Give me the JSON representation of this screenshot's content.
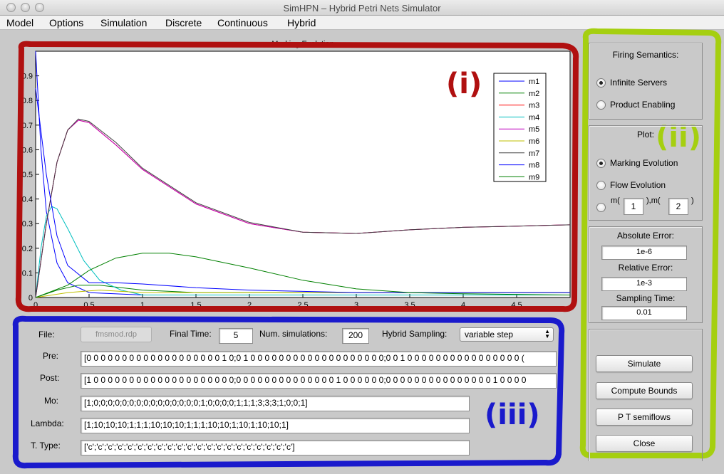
{
  "window": {
    "title": "SimHPN – Hybrid Petri Nets Simulator"
  },
  "menu": [
    "Model",
    "Options",
    "Simulation",
    "Discrete",
    "Continuous",
    "Hybrid"
  ],
  "plot": {
    "title": "Marking Evolution",
    "legend": [
      "m1",
      "m2",
      "m3",
      "m4",
      "m5",
      "m6",
      "m7",
      "m8",
      "m9"
    ]
  },
  "colors": {
    "red_annotation": "#b01010",
    "green_annotation": "#a5cf10",
    "blue_annotation": "#1a1acc"
  },
  "annotations": {
    "i": "(i)",
    "ii": "(ii)",
    "iii": "(iii)"
  },
  "firing": {
    "title": "Firing Semantics:",
    "options": [
      {
        "label": "Infinite Servers",
        "selected": true
      },
      {
        "label": "Product Enabling",
        "selected": false
      }
    ]
  },
  "plot_panel": {
    "title": "Plot:",
    "options": [
      {
        "label": "Marking Evolution",
        "selected": true
      },
      {
        "label": "Flow Evolution",
        "selected": false
      }
    ],
    "m_prefix1": "m(",
    "m_mid": "),m(",
    "m_suffix": ")",
    "m1_value": "1",
    "m2_value": "2"
  },
  "errors": {
    "abs_label": "Absolute Error:",
    "abs_value": "1e-6",
    "rel_label": "Relative Error:",
    "rel_value": "1e-3",
    "samp_label": "Sampling Time:",
    "samp_value": "0.01"
  },
  "buttons": {
    "simulate": "Simulate",
    "compute_bounds": "Compute Bounds",
    "pt_semiflows": "P T semiflows",
    "close": "Close"
  },
  "form": {
    "file_label": "File:",
    "file_button": "fmsmod.rdp",
    "final_time_label": "Final Time:",
    "final_time": "5",
    "num_sim_label": "Num. simulations:",
    "num_sim": "200",
    "hybrid_label": "Hybrid Sampling:",
    "hybrid_value": "variable step",
    "pre_label": "Pre:",
    "pre_value": "[0 0 0 0 0 0 0 0 0 0 0 0 0 0 0 0 0 0 0 1 0;0 1 0 0 0 0 0 0 0 0 0 0 0 0 0 0 0 0 0 0 0;0 0 1 0 0 0 0 0 0 0 0 0 0 0 0 0 0 0 0 (",
    "post_label": "Post:",
    "post_value": "[1 0 0 0 0 0 0 0 0 0 0 0 0 0 0 0 0 0 0 0 0;0 0 0 0 0 0 0 0 0 0 0 0 0 0 1 0 0 0 0 0 0;0 0 0 0 0 0 0 0 0 0 0 0 0 0 0 1 0 0 0 0",
    "mo_label": "Mo:",
    "mo_value": "[1;0;0;0;0;0;0;0;0;0;0;0;0;0;0;0;1;0;0;0;0;1;1;1;3;3;3;1;0;0;1]",
    "lambda_label": "Lambda:",
    "lambda_value": "[1;10;10;10;1;1;1;10;10;10;1;1;1;10;10;1;10;1;10;10;1]",
    "ttype_label": "T. Type:",
    "ttype_value": "['c';'c';'c';'c';'c';'c';'c';'c';'c';'c';'c';'c';'c';'c';'c';'c';'c';'c';'c';'c';'c']"
  },
  "chart_data": {
    "type": "line",
    "title": "Marking Evolution",
    "xlim": [
      0,
      5
    ],
    "ylim": [
      0,
      1
    ],
    "x_ticks": [
      "0",
      "0.5",
      "1",
      "1.5",
      "2",
      "2.5",
      "3",
      "3.5",
      "4",
      "4.5"
    ],
    "y_ticks": [
      "0",
      "0.1",
      "0.2",
      "0.3",
      "0.4",
      "0.5",
      "0.6",
      "0.7",
      "0.8",
      "0.9"
    ],
    "series": [
      {
        "name": "m1",
        "color": "#0000ff",
        "points": [
          [
            0,
            1
          ],
          [
            0.05,
            0.6
          ],
          [
            0.1,
            0.35
          ],
          [
            0.2,
            0.14
          ],
          [
            0.3,
            0.06
          ],
          [
            0.5,
            0.02
          ],
          [
            1,
            0.01
          ],
          [
            5,
            0.01
          ]
        ]
      },
      {
        "name": "m2",
        "color": "#008000",
        "points": [
          [
            0,
            0
          ],
          [
            0.2,
            0.03
          ],
          [
            0.4,
            0.05
          ],
          [
            0.6,
            0.05
          ],
          [
            1,
            0.03
          ],
          [
            1.5,
            0.02
          ],
          [
            5,
            0.02
          ]
        ]
      },
      {
        "name": "m3",
        "color": "#ff0000",
        "points": [
          [
            0,
            0
          ],
          [
            0.1,
            0.3
          ],
          [
            0.2,
            0.55
          ],
          [
            0.3,
            0.68
          ],
          [
            0.4,
            0.72
          ],
          [
            0.5,
            0.71
          ],
          [
            0.75,
            0.62
          ],
          [
            1,
            0.52
          ],
          [
            1.5,
            0.38
          ],
          [
            2,
            0.3
          ],
          [
            2.5,
            0.265
          ],
          [
            3,
            0.26
          ],
          [
            3.5,
            0.275
          ],
          [
            4,
            0.285
          ],
          [
            4.5,
            0.29
          ],
          [
            5,
            0.295
          ]
        ]
      },
      {
        "name": "m4",
        "color": "#00bfbf",
        "points": [
          [
            0,
            0
          ],
          [
            0.05,
            0.2
          ],
          [
            0.1,
            0.33
          ],
          [
            0.15,
            0.37
          ],
          [
            0.2,
            0.36
          ],
          [
            0.3,
            0.28
          ],
          [
            0.45,
            0.15
          ],
          [
            0.6,
            0.07
          ],
          [
            0.8,
            0.03
          ],
          [
            1,
            0.01
          ],
          [
            5,
            0.01
          ]
        ]
      },
      {
        "name": "m5",
        "color": "#bf00bf",
        "points": [
          [
            0,
            0
          ],
          [
            0.1,
            0.3
          ],
          [
            0.2,
            0.55
          ],
          [
            0.3,
            0.68
          ],
          [
            0.4,
            0.72
          ],
          [
            0.5,
            0.71
          ],
          [
            0.75,
            0.62
          ],
          [
            1,
            0.52
          ],
          [
            1.5,
            0.38
          ],
          [
            2,
            0.3
          ],
          [
            2.5,
            0.265
          ],
          [
            3,
            0.26
          ],
          [
            3.5,
            0.275
          ],
          [
            4,
            0.285
          ],
          [
            4.5,
            0.29
          ],
          [
            5,
            0.295
          ]
        ]
      },
      {
        "name": "m6",
        "color": "#bfbf00",
        "points": [
          [
            0,
            0
          ],
          [
            0.3,
            0.02
          ],
          [
            0.6,
            0.03
          ],
          [
            1,
            0.02
          ],
          [
            1.5,
            0.02
          ],
          [
            5,
            0.02
          ]
        ]
      },
      {
        "name": "m7",
        "color": "#404040",
        "points": [
          [
            0,
            0
          ],
          [
            0.1,
            0.3
          ],
          [
            0.2,
            0.55
          ],
          [
            0.3,
            0.68
          ],
          [
            0.4,
            0.725
          ],
          [
            0.5,
            0.715
          ],
          [
            0.75,
            0.63
          ],
          [
            1,
            0.525
          ],
          [
            1.5,
            0.385
          ],
          [
            2,
            0.305
          ],
          [
            2.5,
            0.265
          ],
          [
            3,
            0.26
          ],
          [
            3.5,
            0.275
          ],
          [
            4,
            0.285
          ],
          [
            4.5,
            0.29
          ],
          [
            5,
            0.295
          ]
        ]
      },
      {
        "name": "m8",
        "color": "#0000ff",
        "points": [
          [
            0,
            0.85
          ],
          [
            0.1,
            0.5
          ],
          [
            0.2,
            0.25
          ],
          [
            0.3,
            0.13
          ],
          [
            0.5,
            0.06
          ],
          [
            0.75,
            0.06
          ],
          [
            1,
            0.055
          ],
          [
            1.5,
            0.04
          ],
          [
            2,
            0.03
          ],
          [
            2.5,
            0.025
          ],
          [
            3,
            0.02
          ],
          [
            5,
            0.02
          ]
        ]
      },
      {
        "name": "m9",
        "color": "#008000",
        "points": [
          [
            0,
            0
          ],
          [
            0.3,
            0.05
          ],
          [
            0.5,
            0.11
          ],
          [
            0.75,
            0.16
          ],
          [
            1,
            0.18
          ],
          [
            1.25,
            0.18
          ],
          [
            1.5,
            0.165
          ],
          [
            2,
            0.12
          ],
          [
            2.5,
            0.07
          ],
          [
            3,
            0.035
          ],
          [
            3.5,
            0.02
          ],
          [
            4,
            0.015
          ],
          [
            5,
            0.01
          ]
        ]
      }
    ]
  }
}
